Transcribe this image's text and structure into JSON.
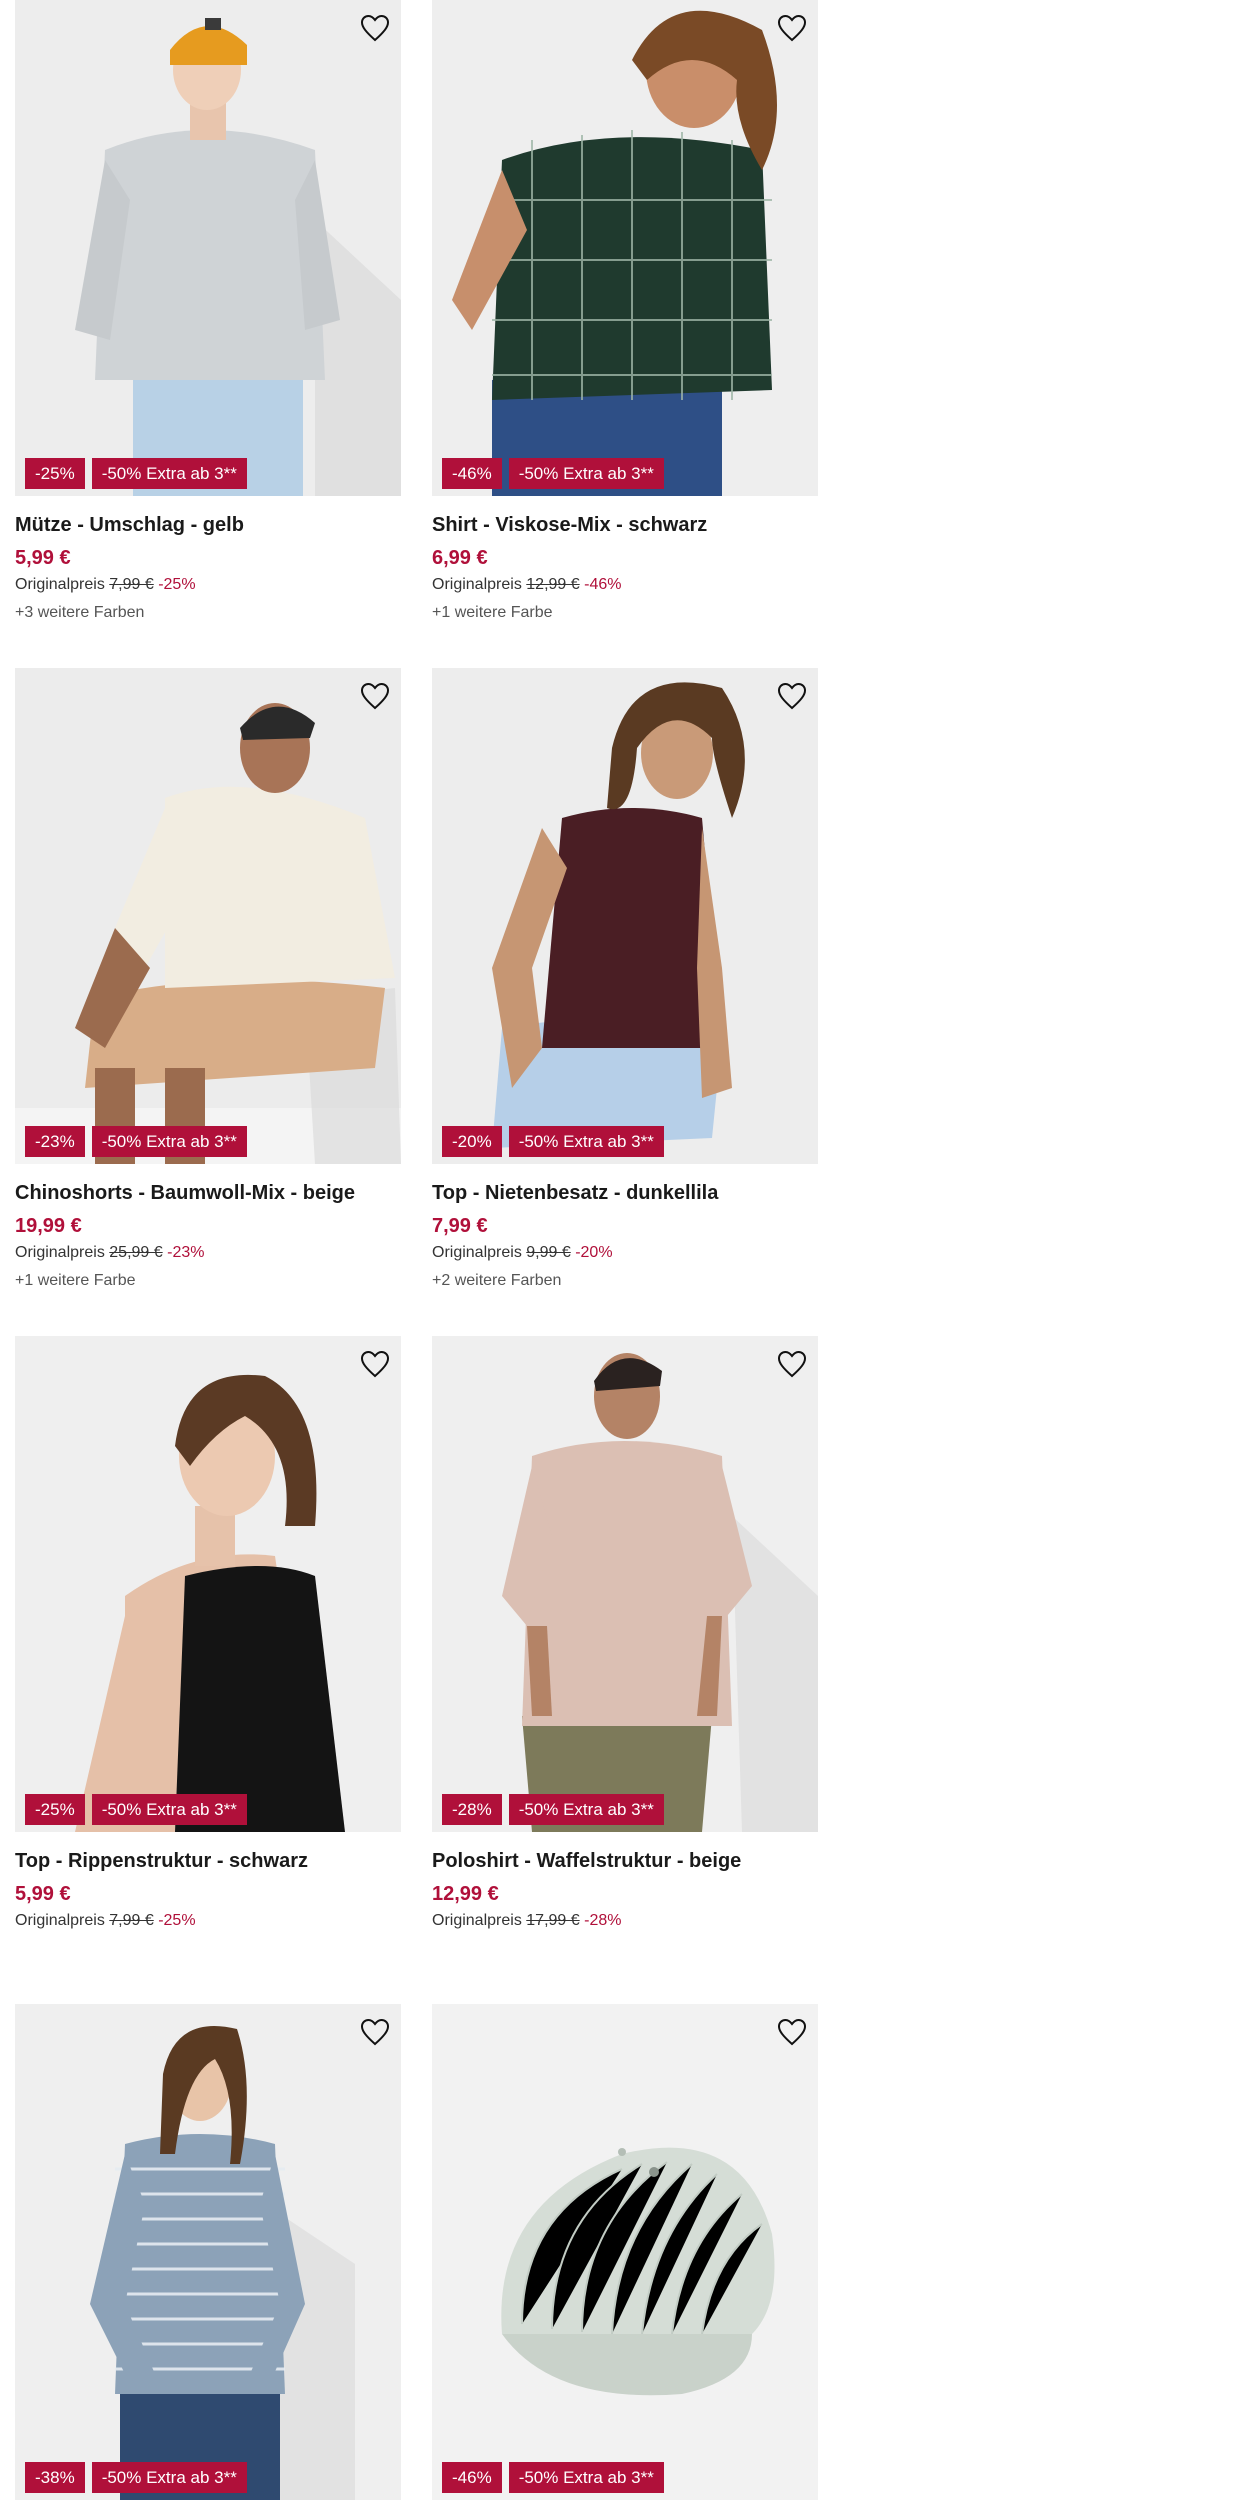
{
  "colors": {
    "accent": "#b0103a",
    "image_bg": "#efefef"
  },
  "products": [
    {
      "title": "Mütze - Umschlag - gelb",
      "price": "5,99 €",
      "original_label": "Originalpreis",
      "original_price": "7,99 €",
      "discount": "-25%",
      "badge_discount": "-25%",
      "badge_extra": "-50% Extra ab 3**",
      "more_colors": "+3 weitere Farben",
      "image": "man-grey-sweater-yellow-beanie",
      "icon": "heart-icon"
    },
    {
      "title": "Shirt - Viskose-Mix - schwarz",
      "price": "6,99 €",
      "original_label": "Originalpreis",
      "original_price": "12,99 €",
      "discount": "-46%",
      "badge_discount": "-46%",
      "badge_extra": "-50% Extra ab 3**",
      "more_colors": "+1 weitere Farbe",
      "image": "woman-checked-shirt",
      "icon": "heart-icon"
    },
    {
      "title": "Chinoshorts - Baumwoll-Mix - beige",
      "price": "19,99 €",
      "original_label": "Originalpreis",
      "original_price": "25,99 €",
      "discount": "-23%",
      "badge_discount": "-23%",
      "badge_extra": "-50% Extra ab 3**",
      "more_colors": "+1 weitere Farbe",
      "image": "man-sitting-beige-shorts",
      "icon": "heart-icon"
    },
    {
      "title": "Top - Nietenbesatz - dunkellila",
      "price": "7,99 €",
      "original_label": "Originalpreis",
      "original_price": "9,99 €",
      "discount": "-20%",
      "badge_discount": "-20%",
      "badge_extra": "-50% Extra ab 3**",
      "more_colors": "+2 weitere Farben",
      "image": "woman-dark-purple-top",
      "icon": "heart-icon"
    },
    {
      "title": "Top - Rippenstruktur - schwarz",
      "price": "5,99 €",
      "original_label": "Originalpreis",
      "original_price": "7,99 €",
      "discount": "-25%",
      "badge_discount": "-25%",
      "badge_extra": "-50% Extra ab 3**",
      "more_colors": "",
      "image": "woman-black-tank-top",
      "icon": "heart-icon"
    },
    {
      "title": "Poloshirt - Waffelstruktur - beige",
      "price": "12,99 €",
      "original_label": "Originalpreis",
      "original_price": "17,99 €",
      "discount": "-28%",
      "badge_discount": "-28%",
      "badge_extra": "-50% Extra ab 3**",
      "more_colors": "",
      "image": "man-beige-polo",
      "icon": "heart-icon"
    },
    {
      "title": "",
      "price": "",
      "original_label": "",
      "original_price": "",
      "discount": "",
      "badge_discount": "-38%",
      "badge_extra": "-50% Extra ab 3**",
      "more_colors": "",
      "image": "woman-striped-longsleeve",
      "icon": "heart-icon"
    },
    {
      "title": "",
      "price": "",
      "original_label": "",
      "original_price": "",
      "discount": "",
      "badge_discount": "-46%",
      "badge_extra": "-50% Extra ab 3**",
      "more_colors": "",
      "image": "light-green-cap",
      "icon": "heart-icon"
    }
  ]
}
